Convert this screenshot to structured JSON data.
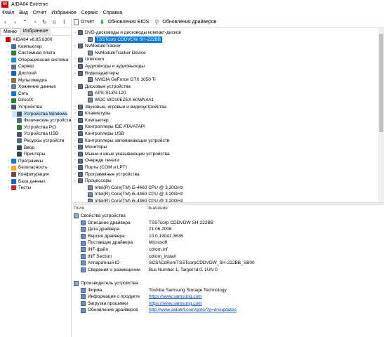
{
  "app": {
    "title": "AIDA64 Extreme",
    "logo": "64"
  },
  "menu": [
    "Файл",
    "Вид",
    "Отчёт",
    "Избранное",
    "Сервис",
    "Справка"
  ],
  "toolbar": {
    "report": "Отчёт",
    "bios": "Обновления BIOS",
    "drivers": "Обновления драйверов"
  },
  "left_tabs": {
    "menu": "Меню",
    "fav": "Избранное"
  },
  "tree": [
    {
      "label": "AIDA64 v6.85.6300",
      "level": 0,
      "exp": "",
      "color": "#c00000"
    },
    {
      "label": "Компьютер",
      "level": 1,
      "exp": "›",
      "color": "#3a6fb0"
    },
    {
      "label": "Системная плата",
      "level": 1,
      "exp": "›",
      "color": "#2e7d32"
    },
    {
      "label": "Операционная система",
      "level": 1,
      "exp": "›",
      "color": "#1e88e5"
    },
    {
      "label": "Сервер",
      "level": 1,
      "exp": "›",
      "color": "#5d6d7e"
    },
    {
      "label": "Дисплей",
      "level": 1,
      "exp": "›",
      "color": "#1565c0"
    },
    {
      "label": "Мультимедиа",
      "level": 1,
      "exp": "›",
      "color": "#8e6d3a"
    },
    {
      "label": "Хранение данных",
      "level": 1,
      "exp": "›",
      "color": "#607d8b"
    },
    {
      "label": "Сеть",
      "level": 1,
      "exp": "›",
      "color": "#1976d2"
    },
    {
      "label": "DirectX",
      "level": 1,
      "exp": "›",
      "color": "#2e7d32"
    },
    {
      "label": "Устройства",
      "level": 1,
      "exp": "⌄",
      "color": "#455a64"
    },
    {
      "label": "Устройства Windows",
      "level": 2,
      "exp": "",
      "color": "#455a64",
      "selected": true
    },
    {
      "label": "Физические устройств",
      "level": 2,
      "exp": "",
      "color": "#546e7a"
    },
    {
      "label": "Устройства PCI",
      "level": 2,
      "exp": "",
      "color": "#2e7d32"
    },
    {
      "label": "Устройства USB",
      "level": 2,
      "exp": "",
      "color": "#455a64"
    },
    {
      "label": "Ресурсы устройств",
      "level": 2,
      "exp": "",
      "color": "#546e7a"
    },
    {
      "label": "Ввод",
      "level": 2,
      "exp": "",
      "color": "#37474f"
    },
    {
      "label": "Принтеры",
      "level": 2,
      "exp": "",
      "color": "#37474f"
    },
    {
      "label": "Программы",
      "level": 1,
      "exp": "›",
      "color": "#1976d2"
    },
    {
      "label": "Безопасность",
      "level": 1,
      "exp": "›",
      "color": "#f9a825"
    },
    {
      "label": "Конфигурация",
      "level": 1,
      "exp": "›",
      "color": "#6d4c41"
    },
    {
      "label": "База данных",
      "level": 1,
      "exp": "›",
      "color": "#1565c0"
    },
    {
      "label": "Тесты",
      "level": 1,
      "exp": "›",
      "color": "#c62828"
    }
  ],
  "devices": [
    {
      "label": "DVD-дисководы и дисководы компакт-дисков",
      "level": 0,
      "exp": "⌄"
    },
    {
      "label": "TSSTcorp CDDVDW SH-222BB",
      "level": 1,
      "exp": "",
      "highlight": true
    },
    {
      "label": "NvModuleTracker",
      "level": 0,
      "exp": "⌄"
    },
    {
      "label": "NvModuleTracker Device",
      "level": 1,
      "exp": ""
    },
    {
      "label": "Unknown",
      "level": 0,
      "exp": "›"
    },
    {
      "label": "Аудиовходы и аудиовыходы",
      "level": 0,
      "exp": "›"
    },
    {
      "label": "Видеоадаптеры",
      "level": 0,
      "exp": "⌄"
    },
    {
      "label": "NVIDIA GeForce GTX 1050 Ti",
      "level": 1,
      "exp": ""
    },
    {
      "label": "Дисковые устройства",
      "level": 0,
      "exp": "⌄"
    },
    {
      "label": "APS-SL3N-120",
      "level": 1,
      "exp": ""
    },
    {
      "label": "WDC WD10EZEX-60WN4A1",
      "level": 1,
      "exp": ""
    },
    {
      "label": "Звуковые, игровые и видеоустройства",
      "level": 0,
      "exp": "›"
    },
    {
      "label": "Клавиатуры",
      "level": 0,
      "exp": "›"
    },
    {
      "label": "Компьютер",
      "level": 0,
      "exp": "›"
    },
    {
      "label": "Контроллеры IDE ATA/ATAPI",
      "level": 0,
      "exp": "›"
    },
    {
      "label": "Контроллеры USB",
      "level": 0,
      "exp": "›"
    },
    {
      "label": "Контроллеры запоминающих устройств",
      "level": 0,
      "exp": "›"
    },
    {
      "label": "Мониторы",
      "level": 0,
      "exp": "›"
    },
    {
      "label": "Мыши и иные указывающие устройства",
      "level": 0,
      "exp": "›"
    },
    {
      "label": "Очереди печати",
      "level": 0,
      "exp": "›"
    },
    {
      "label": "Порты (COM и LPT)",
      "level": 0,
      "exp": "›"
    },
    {
      "label": "Программные устройства",
      "level": 0,
      "exp": "›"
    },
    {
      "label": "Процессоры",
      "level": 0,
      "exp": "⌄"
    },
    {
      "label": "Intel(R) Core(TM) i5-4460  CPU @ 3.20GHz",
      "level": 1,
      "exp": ""
    },
    {
      "label": "Intel(R) Core(TM) i5-4460  CPU @ 3.20GHz",
      "level": 1,
      "exp": ""
    },
    {
      "label": "Intel(R) Core(TM) i5-4460  CPU @ 3.20GHz",
      "level": 1,
      "exp": ""
    }
  ],
  "columns": {
    "field": "Поле",
    "value": "Значение"
  },
  "props": [
    {
      "label": "Свойства устройства",
      "value": "",
      "section": true
    },
    {
      "label": "Описание драйвера",
      "value": "TSSTcorp CDDVDW SH-222BB"
    },
    {
      "label": "Дата драйвера",
      "value": "21.06.2006"
    },
    {
      "label": "Версия драйвера",
      "value": "10.0.19041.3636"
    },
    {
      "label": "Поставщик драйвера",
      "value": "Microsoft"
    },
    {
      "label": "INF-файл",
      "value": "cdrom.inf"
    },
    {
      "label": "INF Section",
      "value": "cdrom_install"
    },
    {
      "label": "Аппаратный ID",
      "value": "SCSI\\CdRomTSSTcorpCDDVDW_SH-222BB_SB00"
    },
    {
      "label": "Сведения о размещении",
      "value": "Bus Number 1, Target Id 0, LUN 0"
    },
    {
      "label": "",
      "value": "",
      "blank": true
    },
    {
      "label": "Производитель устройства",
      "value": "",
      "section": true
    },
    {
      "label": "Фирма",
      "value": "Toshiba Samsung Storage Technology"
    },
    {
      "label": "Информация о продукте",
      "value": "https://www.samsung.com",
      "link": true
    },
    {
      "label": "Загрузка прошивки",
      "value": "https://www.samsung.com",
      "link": true
    },
    {
      "label": "Обновление драйверов",
      "value": "http://www.aida64.com/goto/?p=drvupdates",
      "link": true
    }
  ]
}
